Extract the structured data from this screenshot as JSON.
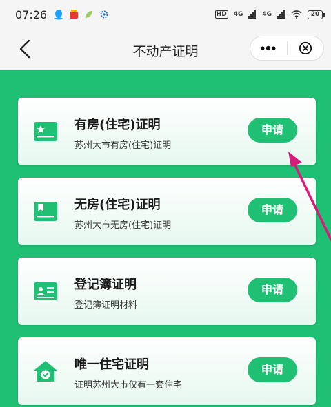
{
  "status_bar": {
    "time": "07:26",
    "net_hd": "HD",
    "net_4g_1": "4G",
    "net_4g_2": "4G",
    "battery": "20"
  },
  "nav": {
    "title": "不动产证明"
  },
  "cards": [
    {
      "title": "有房(住宅)证明",
      "subtitle": "苏州大市有房(住宅)证明",
      "button": "申请"
    },
    {
      "title": "无房(住宅)证明",
      "subtitle": "苏州大市无房(住宅)证明",
      "button": "申请"
    },
    {
      "title": "登记簿证明",
      "subtitle": "登记簿证明材料",
      "button": "申请"
    },
    {
      "title": "唯一住宅证明",
      "subtitle": "证明苏州大市仅有一套住宅",
      "button": "申请"
    }
  ],
  "colors": {
    "accent": "#1fbf74",
    "annotation_arrow": "#d81b7a"
  },
  "icons": {
    "back": "chevron-left-icon",
    "more": "more-dots-icon",
    "close": "close-circle-icon",
    "card_1": "house-cert-star-icon",
    "card_2": "house-cert-icon",
    "card_3": "register-book-icon",
    "card_4": "house-check-icon"
  }
}
